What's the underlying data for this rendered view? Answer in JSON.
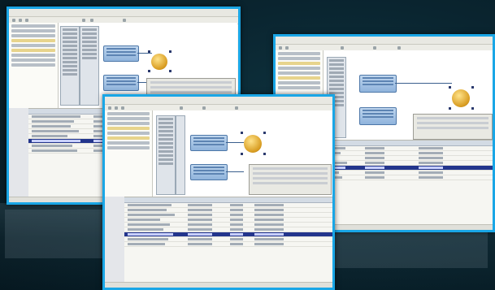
{
  "scene": {
    "background": "#0a2530",
    "frame_color": "#19a6e6",
    "windows": [
      {
        "name": "window-back-left"
      },
      {
        "name": "window-front-center"
      },
      {
        "name": "window-back-right"
      }
    ]
  },
  "icons": {
    "transformer": "gear-icon",
    "node": "feature-node-icon",
    "toolbar": "toolbar-icon"
  }
}
